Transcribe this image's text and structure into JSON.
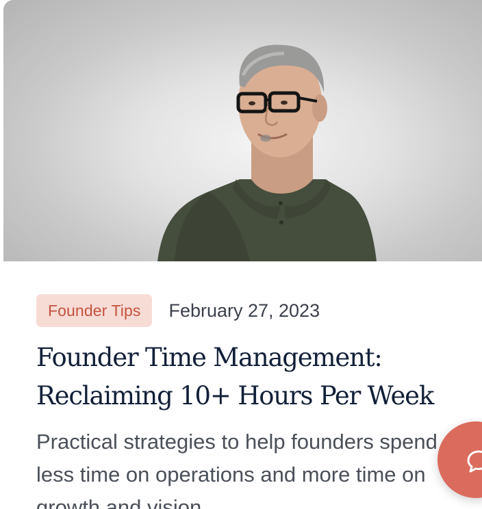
{
  "post": {
    "image_alt": "Smiling man with glasses wearing an olive polo shirt",
    "category": "Founder Tips",
    "date": "February 27, 2023",
    "title": "Founder Time Management: Reclaiming 10+ Hours Per Week",
    "excerpt": "Practical strategies to help founders spend less time on operations and more time on growth and vision."
  },
  "chat": {
    "icon": "chat-bubble-icon"
  },
  "colors": {
    "badge_bg": "#f7dcd6",
    "badge_text": "#c5523f",
    "title": "#122038",
    "chat_button": "#db6b5c"
  }
}
